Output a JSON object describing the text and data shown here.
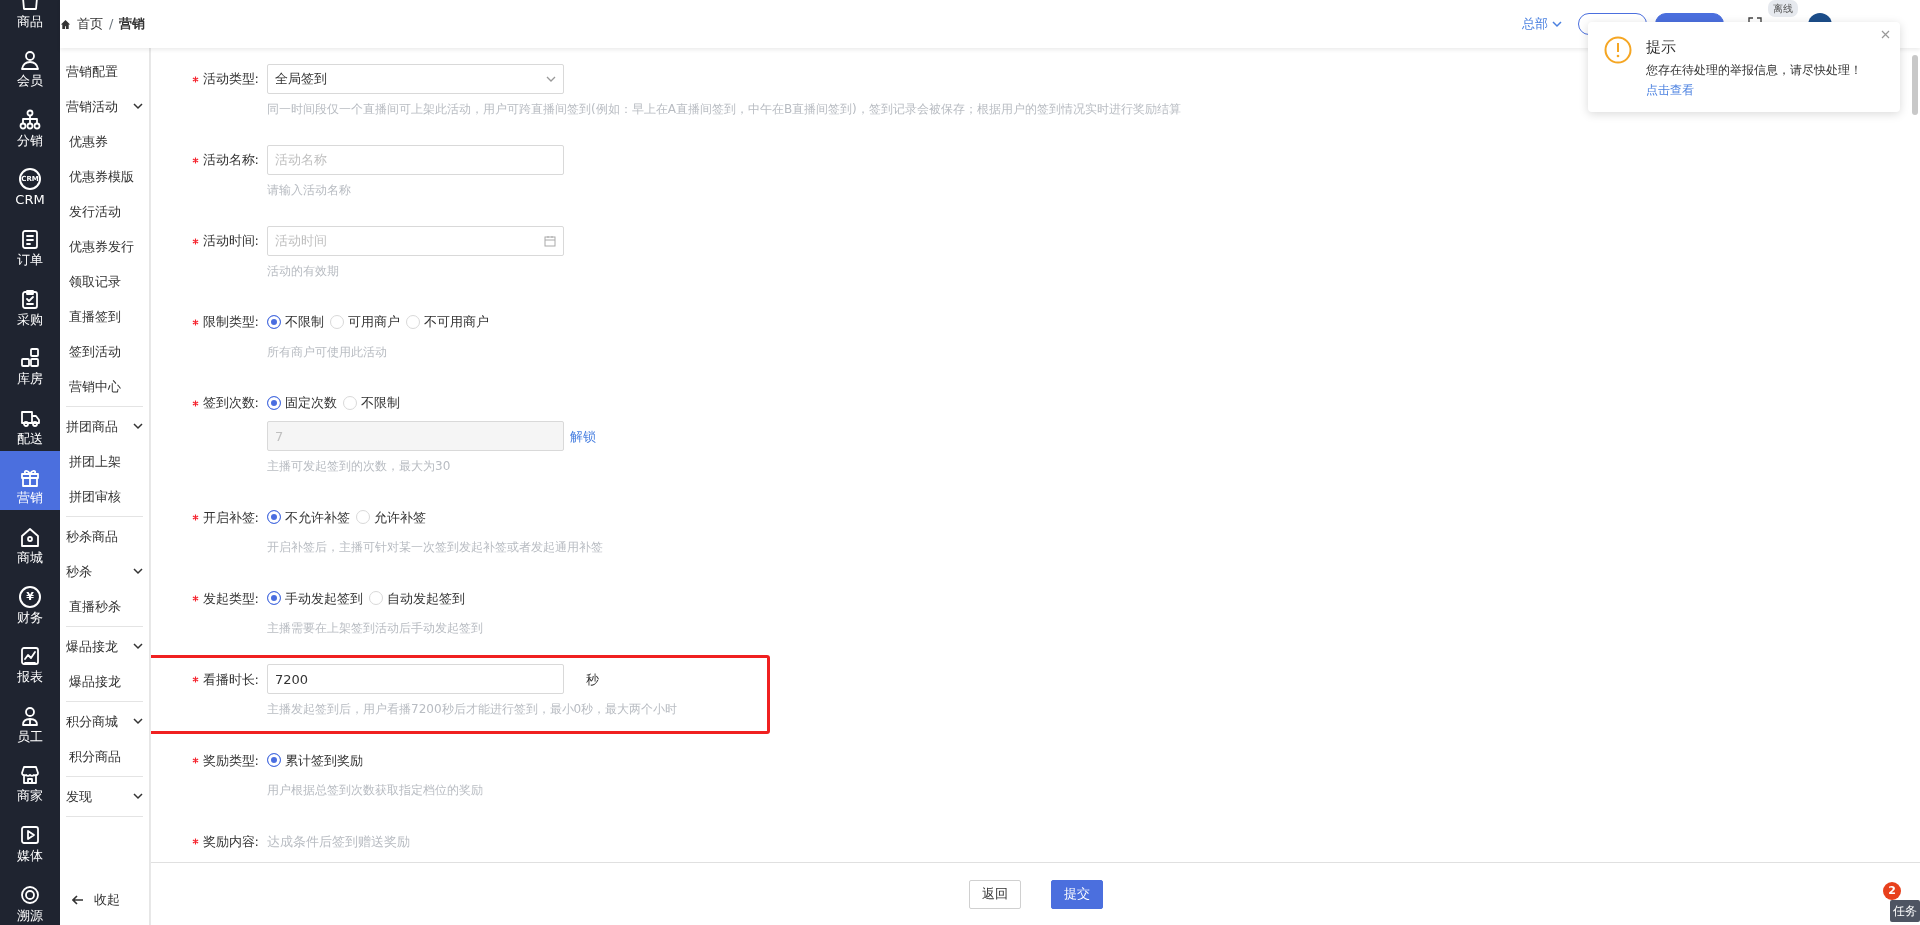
{
  "rail": [
    {
      "label": "商品",
      "selected": false
    },
    {
      "label": "会员",
      "selected": false
    },
    {
      "label": "分销",
      "selected": false
    },
    {
      "label": "CRM",
      "icon_text": "CRM",
      "selected": false
    },
    {
      "label": "订单",
      "selected": false
    },
    {
      "label": "采购",
      "selected": false
    },
    {
      "label": "库房",
      "selected": false
    },
    {
      "label": "配送",
      "selected": false
    },
    {
      "label": "营销",
      "selected": true
    },
    {
      "label": "商城",
      "selected": false
    },
    {
      "label": "财务",
      "icon_text": "¥",
      "selected": false
    },
    {
      "label": "报表",
      "selected": false
    },
    {
      "label": "员工",
      "selected": false
    },
    {
      "label": "商家",
      "selected": false
    },
    {
      "label": "媒体",
      "selected": false
    },
    {
      "label": "溯源",
      "selected": false
    }
  ],
  "submenu": {
    "sections": [
      [
        {
          "label": "营销配置"
        },
        {
          "label": "营销活动",
          "children": [
            "优惠券",
            "优惠券模版",
            "发行活动",
            "优惠券发行",
            "领取记录",
            "直播签到",
            "签到活动",
            "营销中心"
          ]
        }
      ],
      [
        {
          "label": "拼团商品",
          "children": [
            "拼团上架",
            "拼团审核"
          ]
        }
      ],
      [
        {
          "label": "秒杀商品"
        },
        {
          "label": "秒杀",
          "children": [
            "直播秒杀"
          ]
        }
      ],
      [
        {
          "label": "爆品接龙",
          "children": [
            "爆品接龙"
          ]
        }
      ],
      [
        {
          "label": "积分商城",
          "children": [
            "积分商品"
          ]
        }
      ],
      [
        {
          "label": "发现"
        }
      ]
    ],
    "collapse": "收起"
  },
  "breadcrumb": [
    "首页",
    "营销"
  ],
  "breadcrumb_separator": "/",
  "header": {
    "org": "总部",
    "badge": "离线"
  },
  "form": [
    {
      "label": "活动类型:",
      "required": true,
      "kind": "select",
      "value": "全局签到",
      "help": "同一时间段仅一个直播间可上架此活动，用户可跨直播间签到(例如：早上在A直播间签到，中午在B直播间签到)，签到记录会被保存；根据用户的签到情况实时进行奖励结算"
    },
    {
      "label": "活动名称:",
      "required": true,
      "kind": "input",
      "placeholder": "活动名称",
      "help": "请输入活动名称"
    },
    {
      "label": "活动时间:",
      "required": true,
      "kind": "date",
      "placeholder": "活动时间",
      "help": "活动的有效期"
    },
    {
      "label": "限制类型:",
      "required": true,
      "kind": "radio",
      "options": [
        {
          "label": "不限制",
          "selected": true
        },
        {
          "label": "可用商户",
          "selected": false
        },
        {
          "label": "不可用商户",
          "selected": false
        }
      ],
      "help": "所有商户可使用此活动"
    },
    {
      "label": "签到次数:",
      "required": true,
      "kind": "radio",
      "options": [
        {
          "label": "固定次数",
          "selected": true
        },
        {
          "label": "不限制",
          "selected": false
        }
      ],
      "locked_value": "7",
      "unlock": "解锁",
      "help": "主播可发起签到的次数，最大为30"
    },
    {
      "label": "开启补签:",
      "required": true,
      "kind": "radio",
      "options": [
        {
          "label": "不允许补签",
          "selected": true
        },
        {
          "label": "允许补签",
          "selected": false
        }
      ],
      "help": "开启补签后，主播可针对某一次签到发起补签或者发起通用补签"
    },
    {
      "label": "发起类型:",
      "required": true,
      "kind": "radio",
      "options": [
        {
          "label": "手动发起签到",
          "selected": true
        },
        {
          "label": "自动发起签到",
          "selected": false
        }
      ],
      "help": "主播需要在上架签到活动后手动发起签到"
    },
    {
      "label": "看播时长:",
      "required": true,
      "kind": "input",
      "value": "7200",
      "suffix": "秒",
      "highlighted": true,
      "help": "主播发起签到后，用户看播7200秒后才能进行签到，最小0秒，最大两个小时"
    },
    {
      "label": "奖励类型:",
      "required": true,
      "kind": "radio",
      "options": [
        {
          "label": "累计签到奖励",
          "selected": true
        }
      ],
      "help": "用户根据总签到次数获取指定档位的奖励"
    },
    {
      "label": "奖励内容:",
      "required": true,
      "kind": "text",
      "help": "达成条件后签到赠送奖励"
    }
  ],
  "footer": {
    "buttons": [
      {
        "label": "返回",
        "primary": false
      },
      {
        "label": "提交",
        "primary": true
      }
    ]
  },
  "notification": {
    "title": "提示",
    "message": "您存在待处理的举报信息，请尽快处理！",
    "link": "点击查看"
  },
  "task": {
    "label": "任务",
    "count": "2"
  }
}
